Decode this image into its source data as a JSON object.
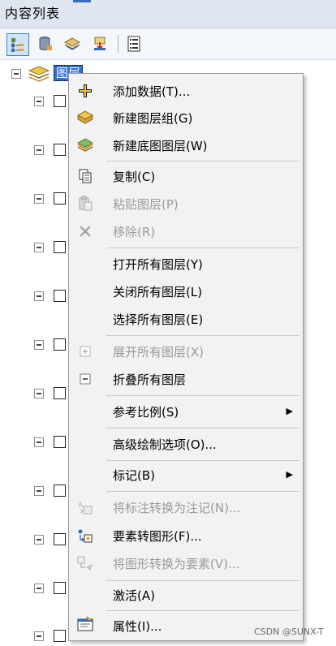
{
  "window": {
    "title": "内容列表"
  },
  "toolbar": {
    "buttons": [
      {
        "icon": "list-by-drawing-order-icon"
      },
      {
        "icon": "list-by-source-icon"
      },
      {
        "icon": "list-by-visibility-icon"
      },
      {
        "icon": "list-by-selection-icon"
      },
      {
        "icon": "options-icon"
      }
    ]
  },
  "tree": {
    "root_label": "图层"
  },
  "context_menu": {
    "items": [
      {
        "label": "添加数据(T)...",
        "icon": "add-data-icon",
        "disabled": false
      },
      {
        "label": "新建图层组(G)",
        "icon": "new-group-layer-icon",
        "disabled": false
      },
      {
        "label": "新建底图图层(W)",
        "icon": "new-basemap-layer-icon",
        "disabled": false
      },
      {
        "label": "复制(C)",
        "icon": "copy-icon",
        "disabled": false
      },
      {
        "label": "粘贴图层(P)",
        "icon": "paste-icon",
        "disabled": true
      },
      {
        "label": "移除(R)",
        "icon": "remove-icon",
        "disabled": true
      },
      {
        "label": "打开所有图层(Y)",
        "icon": "",
        "disabled": false
      },
      {
        "label": "关闭所有图层(L)",
        "icon": "",
        "disabled": false
      },
      {
        "label": "选择所有图层(E)",
        "icon": "",
        "disabled": false
      },
      {
        "label": "展开所有图层(X)",
        "icon": "expand-icon",
        "disabled": true
      },
      {
        "label": "折叠所有图层",
        "icon": "collapse-icon",
        "disabled": false
      },
      {
        "label": "参考比例(S)",
        "icon": "",
        "disabled": false,
        "submenu": true
      },
      {
        "label": "高级绘制选项(O)...",
        "icon": "",
        "disabled": false
      },
      {
        "label": "标记(B)",
        "icon": "",
        "disabled": false,
        "submenu": true
      },
      {
        "label": "将标注转换为注记(N)...",
        "icon": "convert-labels-icon",
        "disabled": true
      },
      {
        "label": "要素转图形(F)...",
        "icon": "features-to-graphics-icon",
        "disabled": false
      },
      {
        "label": "将图形转换为要素(V)...",
        "icon": "graphics-to-features-icon",
        "disabled": true
      },
      {
        "label": "激活(A)",
        "icon": "",
        "disabled": false
      },
      {
        "label": "属性(I)...",
        "icon": "properties-icon",
        "disabled": false
      }
    ],
    "submenu_arrow": "▶"
  },
  "watermark": "CSDN @SUNX-T"
}
